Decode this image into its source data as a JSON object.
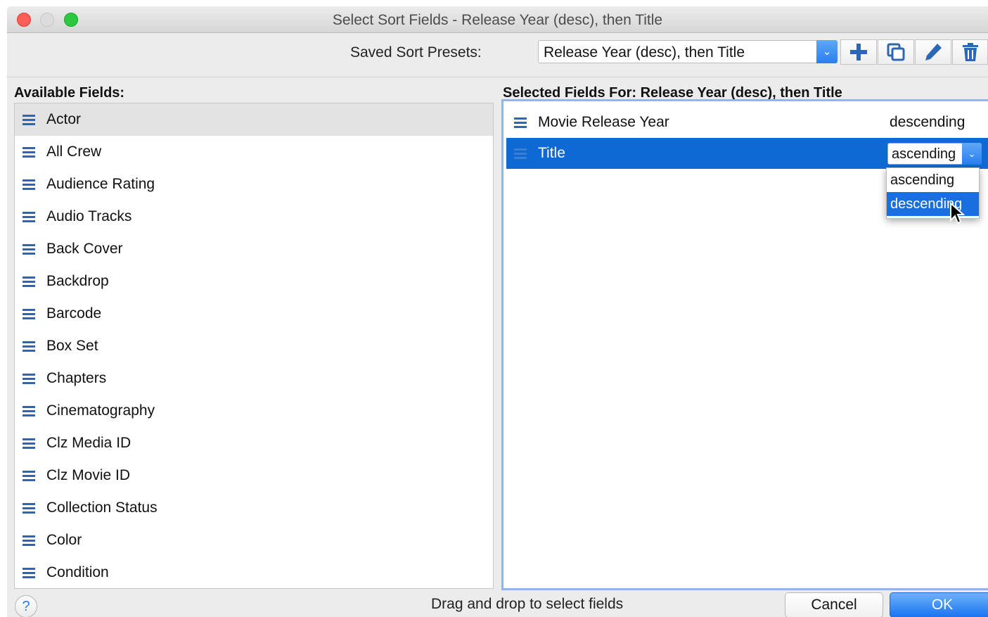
{
  "window": {
    "title": "Select Sort Fields - Release Year (desc), then Title"
  },
  "toolbar": {
    "presets_label": "Saved Sort Presets:",
    "preset_value": "Release Year (desc), then Title",
    "buttons": [
      "plus-icon",
      "copy-icon",
      "pencil-icon",
      "trash-icon"
    ]
  },
  "available": {
    "label": "Available Fields:",
    "items": [
      {
        "label": "Actor"
      },
      {
        "label": "All Crew"
      },
      {
        "label": "Audience Rating"
      },
      {
        "label": "Audio Tracks"
      },
      {
        "label": "Back Cover"
      },
      {
        "label": "Backdrop"
      },
      {
        "label": "Barcode"
      },
      {
        "label": "Box Set"
      },
      {
        "label": "Chapters"
      },
      {
        "label": "Cinematography"
      },
      {
        "label": "Clz Media ID"
      },
      {
        "label": "Clz Movie ID"
      },
      {
        "label": "Collection Status"
      },
      {
        "label": "Color"
      },
      {
        "label": "Condition"
      }
    ]
  },
  "selected": {
    "label": "Selected Fields For:  Release Year (desc), then Title",
    "rows": [
      {
        "label": "Movie Release Year",
        "order": "descending"
      },
      {
        "label": "Title",
        "order": "ascending"
      }
    ],
    "dropdown_options": [
      "ascending",
      "descending"
    ],
    "dropdown_highlighted": "descending"
  },
  "footer": {
    "help": "?",
    "hint": "Drag and drop to select fields",
    "cancel": "Cancel",
    "ok": "OK"
  },
  "colors": {
    "accent": "#0f69d5",
    "close": "#fc5f57",
    "maximize": "#2ac940",
    "icon_blue": "#2b67b5"
  }
}
